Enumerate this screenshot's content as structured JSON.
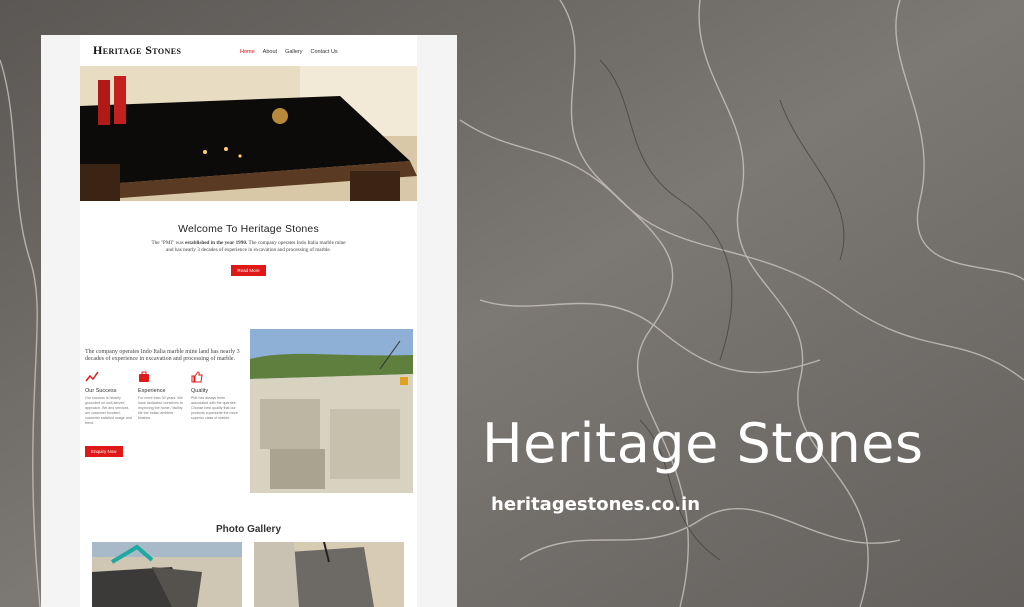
{
  "site": {
    "logo": "Heritage Stones",
    "nav": [
      "Home",
      "About",
      "Gallery",
      "Contact Us"
    ],
    "active_nav": "Home"
  },
  "welcome": {
    "title": "Welcome To Heritage Stones",
    "text_a": "The \"PMI\" was",
    "text_bold": "established in the year 1990.",
    "text_b": "The company operates Indo Italia marble mine and has nearly 3 decades of experience in excavation and processing of marble.",
    "button": "Read More"
  },
  "features": {
    "lead": "The company operates Indo Italia marble mine land has nearly 3 decades of experience in excavation and processing of marble.",
    "items": [
      {
        "icon": "chart-icon",
        "title": "Our Success",
        "text": "Our success is heavily grounded on well-served approach. We and services are customer focused, customer satisfied usage and trend."
      },
      {
        "icon": "briefcase-icon",
        "title": "Experience",
        "text": "For more than 30 years. We have dedicated ourselves to improving the home / facility tile the Indian ambient finishes."
      },
      {
        "icon": "thumbs-up-icon",
        "title": "Quality",
        "text": "PMI has always been associated with the quarries. Choose best quality that our products supersede the more superior class of marble."
      }
    ],
    "button": "Enquiry Now"
  },
  "gallery": {
    "title": "Photo Gallery"
  },
  "overlay": {
    "brand": "Heritage Stones",
    "url": "heritagestones.co.in"
  }
}
